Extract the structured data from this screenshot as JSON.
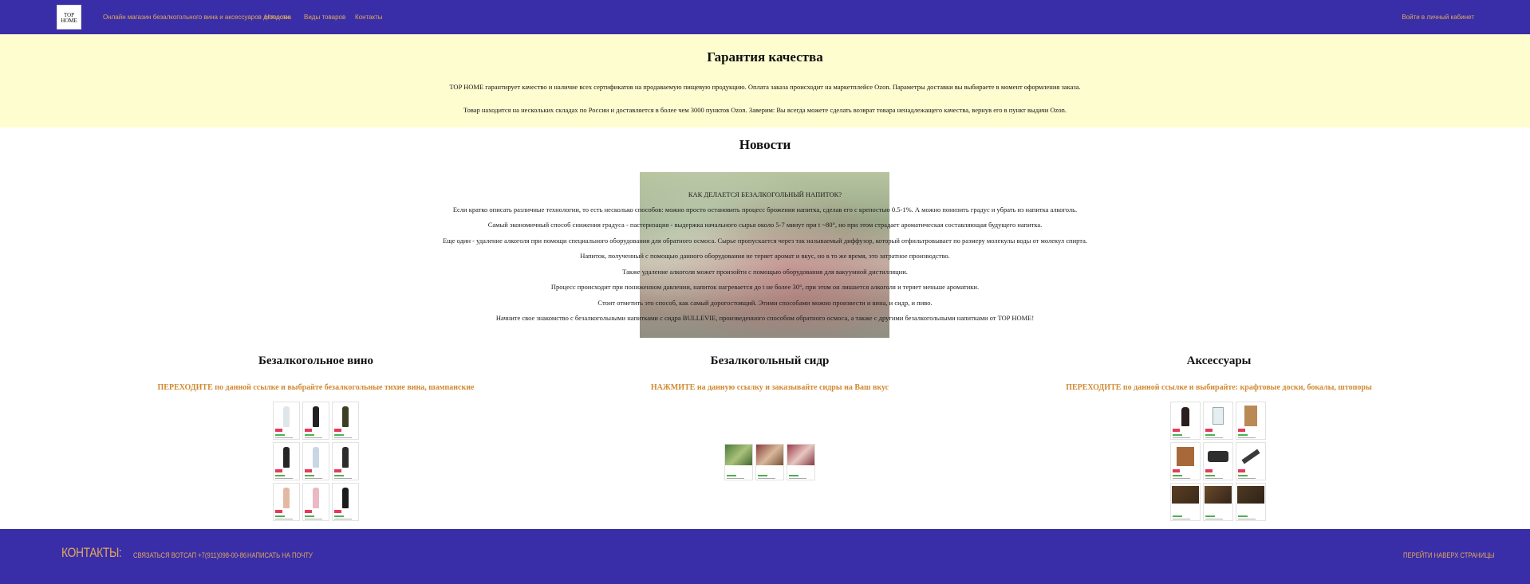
{
  "header": {
    "logo_text": "TOP HOME",
    "nav": [
      "Онлайн магазин безалкогольного вина и аксессуаров для дома",
      "Новости",
      "Виды товаров",
      "Контакты"
    ],
    "login": "Войти в личный кабинет"
  },
  "quality": {
    "title": "Гарантия качества",
    "p1": "TOP HOME гарантирует качество и наличие всех сертификатов на продаваемую пищевую продукцию. Оплата заказа происходит на маркетплейсе Ozon. Параметры доставки вы выбираете в момент оформления заказа.",
    "p2": "Товар находится на нескольких складах по России и доставляется в более чем 3000 пунктов Ozon. Заверим: Вы всегда можете сделать возврат товара ненадлежащего качества, вернув его в пункт выдачи Ozon."
  },
  "news": {
    "title": "Новости",
    "lines": [
      "КАК ДЕЛАЕТСЯ БЕЗАЛКОГОЛЬНЫЙ НАПИТОК?",
      "Если кратко описать различные технологии, то есть несколько способов: можно просто остановить процесс брожения напитка, сделав его с крепостью 0.5-1%. А можно понизить градус и убрать из напитка алкоголь.",
      "Самый экономичный способ снижения градуса - пастеризация - выдержка начального сырья около 5-7 минут при t ~80°, но при этом страдает ароматическая составляющая будущего напитка.",
      "Еще один - удаление алкоголя при помощи специального оборудования для обратного осмоса. Сырье пропускается через так называемый диффузор, который отфильтровывает по размеру молекулы воды от молекул спирта.",
      "Напиток, полученный с помощью данного оборудования не теряет аромат и вкус, но в то же время, это затратное производство.",
      "Также удаление алкоголя может произойти с помощью оборудования для вакуумной дистилляции.",
      "Процесс происходит при пониженном давлении, напиток нагревается до t не более 30°, при этом он лишается алкоголя и теряет меньше ароматики.",
      "Стоит отметить это способ, как самый дорогостоящий. Этими способами можно произвести и вина, и сидр, и пиво.",
      "Начните свое знакомство с безалкогольными напитками с сидра BULLEVIE, произведенного способом обратного осмоса, а также с другими безалкогольными напитками от TOP HOME!"
    ]
  },
  "categories": [
    {
      "title": "Безалкогольное вино",
      "link": "ПЕРЕХОДИТЕ по данной ссылке и выбрайте безалкогольные тихие вина, шампанские"
    },
    {
      "title": "Безалкогольный сидр",
      "link": "НАЖМИТЕ на данную ссылку и заказывайте сидры на Ваш вкус"
    },
    {
      "title": "Аксессуары",
      "link": "ПЕРЕХОДИТЕ по данной ссылке и выбирайте: крафтовые доски, бокалы, штопоры"
    }
  ],
  "footer": {
    "title": "КОНТАКТЫ:",
    "whatsapp": "СВЯЗАТЬСЯ ВОТСАП +7(911)098-00-86",
    "email": "НАПИСАТЬ НА ПОЧТУ",
    "to_top": "ПЕРЕЙТИ НАВЕРХ СТРАНИЦЫ"
  },
  "colors": {
    "header_bg": "#3a2ea8",
    "accent": "#e0a85a",
    "link": "#d08a32",
    "quality_bg": "#fefdd0"
  }
}
